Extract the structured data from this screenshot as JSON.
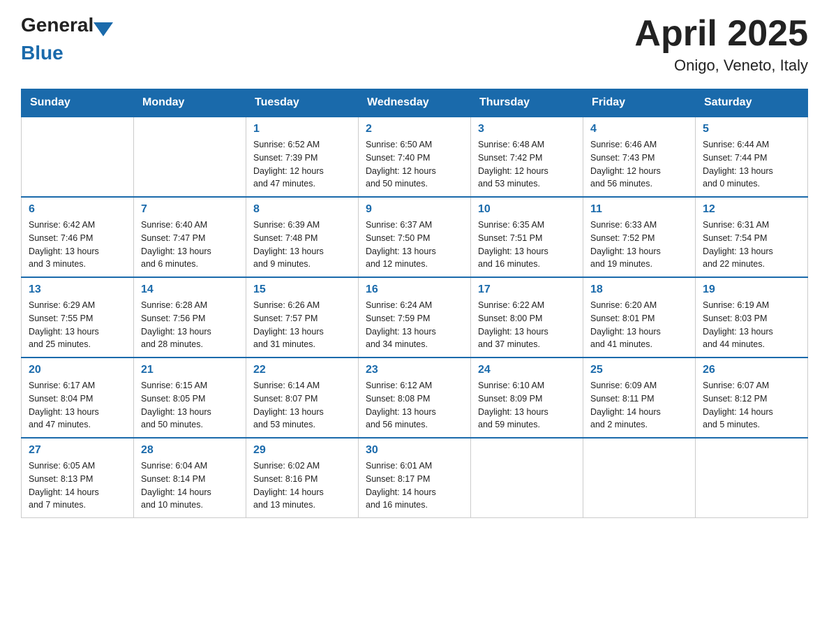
{
  "header": {
    "logo_general": "General",
    "logo_blue": "Blue",
    "title": "April 2025",
    "subtitle": "Onigo, Veneto, Italy"
  },
  "weekdays": [
    "Sunday",
    "Monday",
    "Tuesday",
    "Wednesday",
    "Thursday",
    "Friday",
    "Saturday"
  ],
  "weeks": [
    [
      {
        "day": "",
        "info": ""
      },
      {
        "day": "",
        "info": ""
      },
      {
        "day": "1",
        "info": "Sunrise: 6:52 AM\nSunset: 7:39 PM\nDaylight: 12 hours\nand 47 minutes."
      },
      {
        "day": "2",
        "info": "Sunrise: 6:50 AM\nSunset: 7:40 PM\nDaylight: 12 hours\nand 50 minutes."
      },
      {
        "day": "3",
        "info": "Sunrise: 6:48 AM\nSunset: 7:42 PM\nDaylight: 12 hours\nand 53 minutes."
      },
      {
        "day": "4",
        "info": "Sunrise: 6:46 AM\nSunset: 7:43 PM\nDaylight: 12 hours\nand 56 minutes."
      },
      {
        "day": "5",
        "info": "Sunrise: 6:44 AM\nSunset: 7:44 PM\nDaylight: 13 hours\nand 0 minutes."
      }
    ],
    [
      {
        "day": "6",
        "info": "Sunrise: 6:42 AM\nSunset: 7:46 PM\nDaylight: 13 hours\nand 3 minutes."
      },
      {
        "day": "7",
        "info": "Sunrise: 6:40 AM\nSunset: 7:47 PM\nDaylight: 13 hours\nand 6 minutes."
      },
      {
        "day": "8",
        "info": "Sunrise: 6:39 AM\nSunset: 7:48 PM\nDaylight: 13 hours\nand 9 minutes."
      },
      {
        "day": "9",
        "info": "Sunrise: 6:37 AM\nSunset: 7:50 PM\nDaylight: 13 hours\nand 12 minutes."
      },
      {
        "day": "10",
        "info": "Sunrise: 6:35 AM\nSunset: 7:51 PM\nDaylight: 13 hours\nand 16 minutes."
      },
      {
        "day": "11",
        "info": "Sunrise: 6:33 AM\nSunset: 7:52 PM\nDaylight: 13 hours\nand 19 minutes."
      },
      {
        "day": "12",
        "info": "Sunrise: 6:31 AM\nSunset: 7:54 PM\nDaylight: 13 hours\nand 22 minutes."
      }
    ],
    [
      {
        "day": "13",
        "info": "Sunrise: 6:29 AM\nSunset: 7:55 PM\nDaylight: 13 hours\nand 25 minutes."
      },
      {
        "day": "14",
        "info": "Sunrise: 6:28 AM\nSunset: 7:56 PM\nDaylight: 13 hours\nand 28 minutes."
      },
      {
        "day": "15",
        "info": "Sunrise: 6:26 AM\nSunset: 7:57 PM\nDaylight: 13 hours\nand 31 minutes."
      },
      {
        "day": "16",
        "info": "Sunrise: 6:24 AM\nSunset: 7:59 PM\nDaylight: 13 hours\nand 34 minutes."
      },
      {
        "day": "17",
        "info": "Sunrise: 6:22 AM\nSunset: 8:00 PM\nDaylight: 13 hours\nand 37 minutes."
      },
      {
        "day": "18",
        "info": "Sunrise: 6:20 AM\nSunset: 8:01 PM\nDaylight: 13 hours\nand 41 minutes."
      },
      {
        "day": "19",
        "info": "Sunrise: 6:19 AM\nSunset: 8:03 PM\nDaylight: 13 hours\nand 44 minutes."
      }
    ],
    [
      {
        "day": "20",
        "info": "Sunrise: 6:17 AM\nSunset: 8:04 PM\nDaylight: 13 hours\nand 47 minutes."
      },
      {
        "day": "21",
        "info": "Sunrise: 6:15 AM\nSunset: 8:05 PM\nDaylight: 13 hours\nand 50 minutes."
      },
      {
        "day": "22",
        "info": "Sunrise: 6:14 AM\nSunset: 8:07 PM\nDaylight: 13 hours\nand 53 minutes."
      },
      {
        "day": "23",
        "info": "Sunrise: 6:12 AM\nSunset: 8:08 PM\nDaylight: 13 hours\nand 56 minutes."
      },
      {
        "day": "24",
        "info": "Sunrise: 6:10 AM\nSunset: 8:09 PM\nDaylight: 13 hours\nand 59 minutes."
      },
      {
        "day": "25",
        "info": "Sunrise: 6:09 AM\nSunset: 8:11 PM\nDaylight: 14 hours\nand 2 minutes."
      },
      {
        "day": "26",
        "info": "Sunrise: 6:07 AM\nSunset: 8:12 PM\nDaylight: 14 hours\nand 5 minutes."
      }
    ],
    [
      {
        "day": "27",
        "info": "Sunrise: 6:05 AM\nSunset: 8:13 PM\nDaylight: 14 hours\nand 7 minutes."
      },
      {
        "day": "28",
        "info": "Sunrise: 6:04 AM\nSunset: 8:14 PM\nDaylight: 14 hours\nand 10 minutes."
      },
      {
        "day": "29",
        "info": "Sunrise: 6:02 AM\nSunset: 8:16 PM\nDaylight: 14 hours\nand 13 minutes."
      },
      {
        "day": "30",
        "info": "Sunrise: 6:01 AM\nSunset: 8:17 PM\nDaylight: 14 hours\nand 16 minutes."
      },
      {
        "day": "",
        "info": ""
      },
      {
        "day": "",
        "info": ""
      },
      {
        "day": "",
        "info": ""
      }
    ]
  ]
}
